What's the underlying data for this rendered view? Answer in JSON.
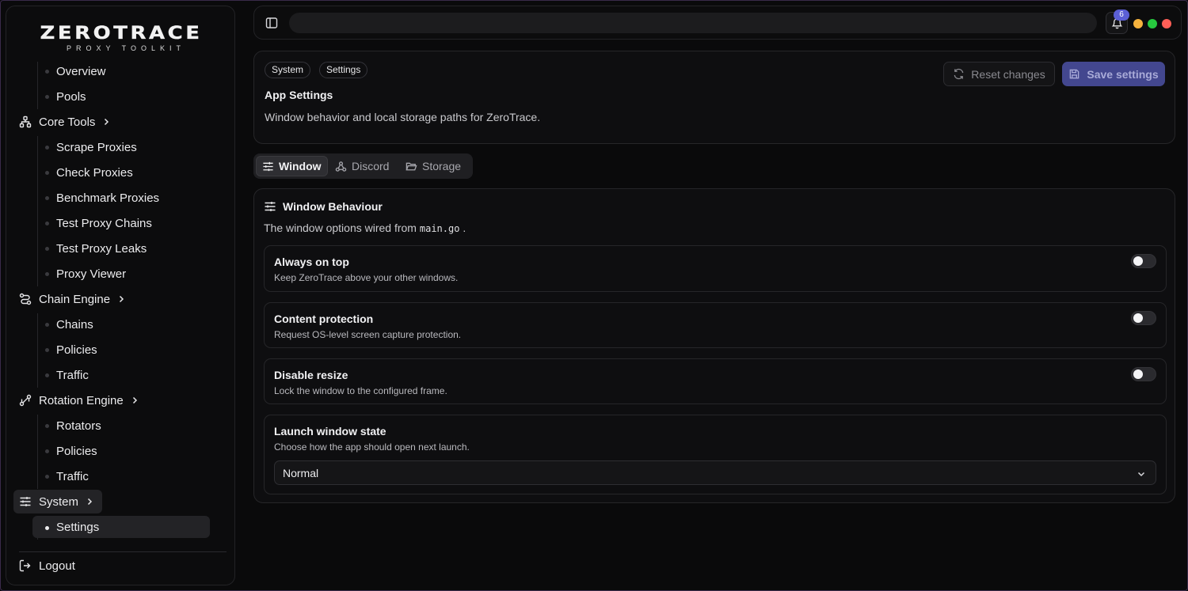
{
  "brand": {
    "name": "ZEROTRACE",
    "tagline": "PROXY TOOLKIT"
  },
  "sidebar": {
    "overview": "Overview",
    "pools": "Pools",
    "core_tools": {
      "label": "Core Tools",
      "items": [
        "Scrape Proxies",
        "Check Proxies",
        "Benchmark Proxies",
        "Test Proxy Chains",
        "Test Proxy Leaks",
        "Proxy Viewer"
      ]
    },
    "chain_engine": {
      "label": "Chain Engine",
      "items": [
        "Chains",
        "Policies",
        "Traffic"
      ]
    },
    "rotation_engine": {
      "label": "Rotation Engine",
      "items": [
        "Rotators",
        "Policies",
        "Traffic"
      ]
    },
    "system": {
      "label": "System",
      "items": [
        "Settings"
      ]
    },
    "logout": "Logout"
  },
  "topbar": {
    "search_placeholder": "",
    "notification_count": "6",
    "window_dots": [
      "#f5b23d",
      "#27c93f",
      "#ff5f57"
    ]
  },
  "header": {
    "breadcrumbs": [
      "System",
      "Settings"
    ],
    "title": "App Settings",
    "description": "Window behavior and local storage paths for ZeroTrace.",
    "reset_label": "Reset changes",
    "save_label": "Save settings"
  },
  "tabs": [
    "Window",
    "Discord",
    "Storage"
  ],
  "active_tab": "Window",
  "section": {
    "title": "Window Behaviour",
    "desc_prefix": "The window options wired from",
    "desc_code": "main.go",
    "desc_suffix": ".",
    "options": [
      {
        "title": "Always on top",
        "desc": "Keep ZeroTrace above your other windows.",
        "enabled": false
      },
      {
        "title": "Content protection",
        "desc": "Request OS-level screen capture protection.",
        "enabled": false
      },
      {
        "title": "Disable resize",
        "desc": "Lock the window to the configured frame.",
        "enabled": false
      }
    ],
    "launch_state": {
      "title": "Launch window state",
      "desc": "Choose how the app should open next launch.",
      "value": "Normal"
    }
  },
  "colors": {
    "accent": "#43478f",
    "badge": "#5b5fd6",
    "background": "#0a0a0b"
  }
}
